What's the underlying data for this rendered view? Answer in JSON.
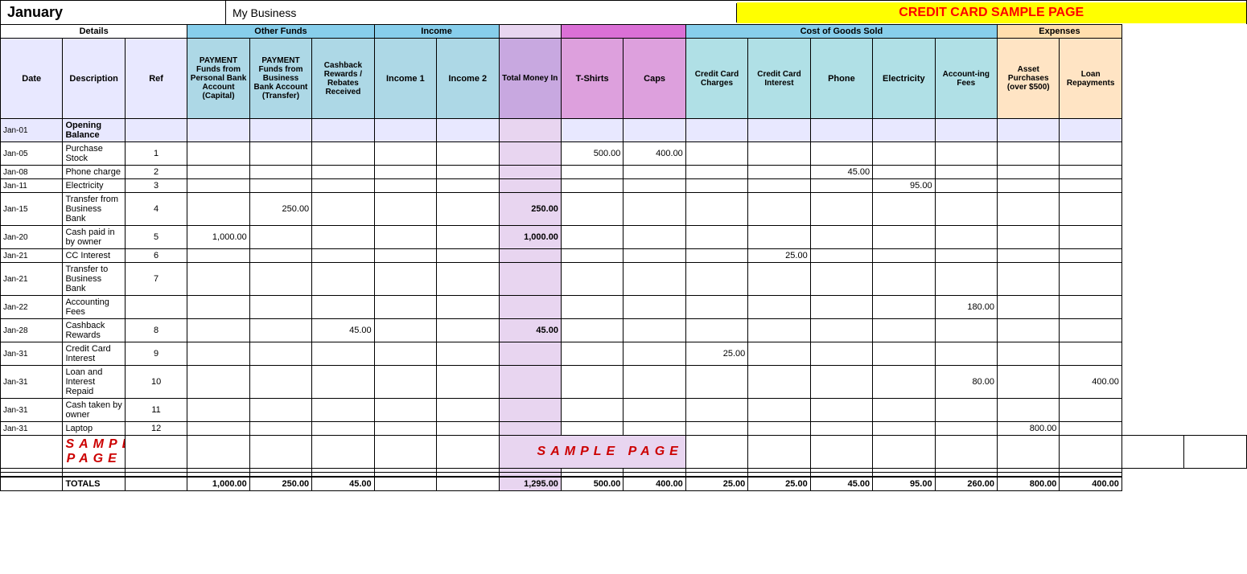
{
  "header": {
    "month": "January",
    "business": "My Business",
    "title": "CREDIT CARD SAMPLE PAGE"
  },
  "col_groups": [
    {
      "label": "Details",
      "colspan": 3,
      "class": "col-details"
    },
    {
      "label": "Other Funds",
      "colspan": 3,
      "class": "col-other-funds"
    },
    {
      "label": "Income",
      "colspan": 2,
      "class": "col-income"
    },
    {
      "label": "",
      "colspan": 1,
      "class": ""
    },
    {
      "label": "Cost of Goods Sold",
      "colspan": 2,
      "class": "col-cogs"
    },
    {
      "label": "Expenses",
      "colspan": 5,
      "class": "col-expenses"
    },
    {
      "label": "Other Funds",
      "colspan": 2,
      "class": "col-other-funds2"
    }
  ],
  "sub_headers": {
    "date": "Date",
    "description": "Description",
    "ref": "Ref",
    "payment_personal": "PAYMENT Funds from Personal Bank Account (Capital)",
    "payment_business": "PAYMENT Funds from Business Bank Account (Transfer)",
    "cashback": "Cashback Rewards / Rebates Received",
    "income1": "Income 1",
    "income2": "Income 2",
    "total_money_in": "Total Money In",
    "tshirts": "T-Shirts",
    "caps": "Caps",
    "cc_charges": "Credit Card Charges",
    "cc_interest": "Credit Card Interest",
    "phone": "Phone",
    "electricity": "Electricity",
    "accounting_fees": "Account-ing Fees",
    "asset_purchases": "Asset Purchases (over $500)",
    "loan_repayments": "Loan Repayments"
  },
  "rows": [
    {
      "date": "Jan-01",
      "desc": "Opening Balance",
      "ref": "",
      "pay_personal": "",
      "pay_business": "",
      "cashback": "",
      "income1": "",
      "income2": "",
      "total_money": "",
      "tshirts": "",
      "caps": "",
      "cc_charges": "",
      "cc_interest": "",
      "phone": "",
      "electricity": "",
      "acct_fees": "",
      "asset_purch": "",
      "loan_repay": "",
      "type": "opening"
    },
    {
      "date": "Jan-05",
      "desc": "Purchase Stock",
      "ref": "1",
      "pay_personal": "",
      "pay_business": "",
      "cashback": "",
      "income1": "",
      "income2": "",
      "total_money": "",
      "tshirts": "500.00",
      "caps": "400.00",
      "cc_charges": "",
      "cc_interest": "",
      "phone": "",
      "electricity": "",
      "acct_fees": "",
      "asset_purch": "",
      "loan_repay": ""
    },
    {
      "date": "Jan-08",
      "desc": "Phone charge",
      "ref": "2",
      "pay_personal": "",
      "pay_business": "",
      "cashback": "",
      "income1": "",
      "income2": "",
      "total_money": "",
      "tshirts": "",
      "caps": "",
      "cc_charges": "",
      "cc_interest": "",
      "phone": "45.00",
      "electricity": "",
      "acct_fees": "",
      "asset_purch": "",
      "loan_repay": ""
    },
    {
      "date": "Jan-11",
      "desc": "Electricity",
      "ref": "3",
      "pay_personal": "",
      "pay_business": "",
      "cashback": "",
      "income1": "",
      "income2": "",
      "total_money": "",
      "tshirts": "",
      "caps": "",
      "cc_charges": "",
      "cc_interest": "",
      "phone": "",
      "electricity": "95.00",
      "acct_fees": "",
      "asset_purch": "",
      "loan_repay": ""
    },
    {
      "date": "Jan-15",
      "desc": "Transfer from Business Bank",
      "ref": "4",
      "pay_personal": "",
      "pay_business": "250.00",
      "cashback": "",
      "income1": "",
      "income2": "",
      "total_money": "250.00",
      "tshirts": "",
      "caps": "",
      "cc_charges": "",
      "cc_interest": "",
      "phone": "",
      "electricity": "",
      "acct_fees": "",
      "asset_purch": "",
      "loan_repay": ""
    },
    {
      "date": "Jan-20",
      "desc": "Cash paid in by owner",
      "ref": "5",
      "pay_personal": "1,000.00",
      "pay_business": "",
      "cashback": "",
      "income1": "",
      "income2": "",
      "total_money": "1,000.00",
      "tshirts": "",
      "caps": "",
      "cc_charges": "",
      "cc_interest": "",
      "phone": "",
      "electricity": "",
      "acct_fees": "",
      "asset_purch": "",
      "loan_repay": ""
    },
    {
      "date": "Jan-21",
      "desc": "CC Interest",
      "ref": "6",
      "pay_personal": "",
      "pay_business": "",
      "cashback": "",
      "income1": "",
      "income2": "",
      "total_money": "",
      "tshirts": "",
      "caps": "",
      "cc_charges": "",
      "cc_interest": "25.00",
      "phone": "",
      "electricity": "",
      "acct_fees": "",
      "asset_purch": "",
      "loan_repay": ""
    },
    {
      "date": "Jan-21",
      "desc": "Transfer to Business Bank",
      "ref": "7",
      "pay_personal": "",
      "pay_business": "",
      "cashback": "",
      "income1": "",
      "income2": "",
      "total_money": "",
      "tshirts": "",
      "caps": "",
      "cc_charges": "",
      "cc_interest": "",
      "phone": "",
      "electricity": "",
      "acct_fees": "",
      "asset_purch": "",
      "loan_repay": ""
    },
    {
      "date": "Jan-22",
      "desc": "Accounting Fees",
      "ref": "",
      "pay_personal": "",
      "pay_business": "",
      "cashback": "",
      "income1": "",
      "income2": "",
      "total_money": "",
      "tshirts": "",
      "caps": "",
      "cc_charges": "",
      "cc_interest": "",
      "phone": "",
      "electricity": "",
      "acct_fees": "180.00",
      "asset_purch": "",
      "loan_repay": ""
    },
    {
      "date": "Jan-28",
      "desc": "Cashback Rewards",
      "ref": "8",
      "pay_personal": "",
      "pay_business": "",
      "cashback": "45.00",
      "income1": "",
      "income2": "",
      "total_money": "45.00",
      "tshirts": "",
      "caps": "",
      "cc_charges": "",
      "cc_interest": "",
      "phone": "",
      "electricity": "",
      "acct_fees": "",
      "asset_purch": "",
      "loan_repay": ""
    },
    {
      "date": "Jan-31",
      "desc": "Credit Card Interest",
      "ref": "9",
      "pay_personal": "",
      "pay_business": "",
      "cashback": "",
      "income1": "",
      "income2": "",
      "total_money": "",
      "tshirts": "",
      "caps": "",
      "cc_charges": "25.00",
      "cc_interest": "",
      "phone": "",
      "electricity": "",
      "acct_fees": "",
      "asset_purch": "",
      "loan_repay": ""
    },
    {
      "date": "Jan-31",
      "desc": "Loan and Interest Repaid",
      "ref": "10",
      "pay_personal": "",
      "pay_business": "",
      "cashback": "",
      "income1": "",
      "income2": "",
      "total_money": "",
      "tshirts": "",
      "caps": "",
      "cc_charges": "",
      "cc_interest": "",
      "phone": "",
      "electricity": "",
      "acct_fees": "80.00",
      "asset_purch": "",
      "loan_repay": "400.00"
    },
    {
      "date": "Jan-31",
      "desc": "Cash taken by owner",
      "ref": "11",
      "pay_personal": "",
      "pay_business": "",
      "cashback": "",
      "income1": "",
      "income2": "",
      "total_money": "",
      "tshirts": "",
      "caps": "",
      "cc_charges": "",
      "cc_interest": "",
      "phone": "",
      "electricity": "",
      "acct_fees": "",
      "asset_purch": "",
      "loan_repay": ""
    },
    {
      "date": "Jan-31",
      "desc": "Laptop",
      "ref": "12",
      "pay_personal": "",
      "pay_business": "",
      "cashback": "",
      "income1": "",
      "income2": "",
      "total_money": "",
      "tshirts": "",
      "caps": "",
      "cc_charges": "",
      "cc_interest": "",
      "phone": "",
      "electricity": "",
      "acct_fees": "",
      "asset_purch": "800.00",
      "loan_repay": ""
    },
    {
      "date": "",
      "desc": "",
      "ref": "",
      "pay_personal": "",
      "pay_business": "",
      "cashback": "",
      "income1": "",
      "income2": "",
      "total_money": "",
      "tshirts": "",
      "caps": "",
      "cc_charges": "",
      "cc_interest": "",
      "phone": "",
      "electricity": "",
      "acct_fees": "",
      "asset_purch": "",
      "loan_repay": ""
    },
    {
      "date": "",
      "desc": "",
      "ref": "",
      "pay_personal": "",
      "pay_business": "",
      "cashback": "",
      "income1": "",
      "income2": "",
      "total_money": "",
      "tshirts": "",
      "caps": "",
      "cc_charges": "",
      "cc_interest": "",
      "phone": "",
      "electricity": "",
      "acct_fees": "",
      "asset_purch": "",
      "loan_repay": ""
    },
    {
      "date": "",
      "desc": "",
      "ref": "",
      "pay_personal": "",
      "pay_business": "",
      "cashback": "",
      "income1": "",
      "income2": "",
      "total_money": "",
      "tshirts": "",
      "caps": "",
      "cc_charges": "",
      "cc_interest": "",
      "phone": "",
      "electricity": "",
      "acct_fees": "",
      "asset_purch": "",
      "loan_repay": ""
    }
  ],
  "totals": {
    "label": "TOTALS",
    "pay_personal": "1,000.00",
    "pay_business": "250.00",
    "cashback": "45.00",
    "income1": "",
    "income2": "",
    "total_money": "1,295.00",
    "tshirts": "500.00",
    "caps": "400.00",
    "cc_charges": "25.00",
    "cc_interest": "25.00",
    "phone": "45.00",
    "electricity": "95.00",
    "acct_fees": "260.00",
    "asset_purch": "800.00",
    "loan_repay": "400.00"
  },
  "sample_text": "SAMPLE PAGE"
}
